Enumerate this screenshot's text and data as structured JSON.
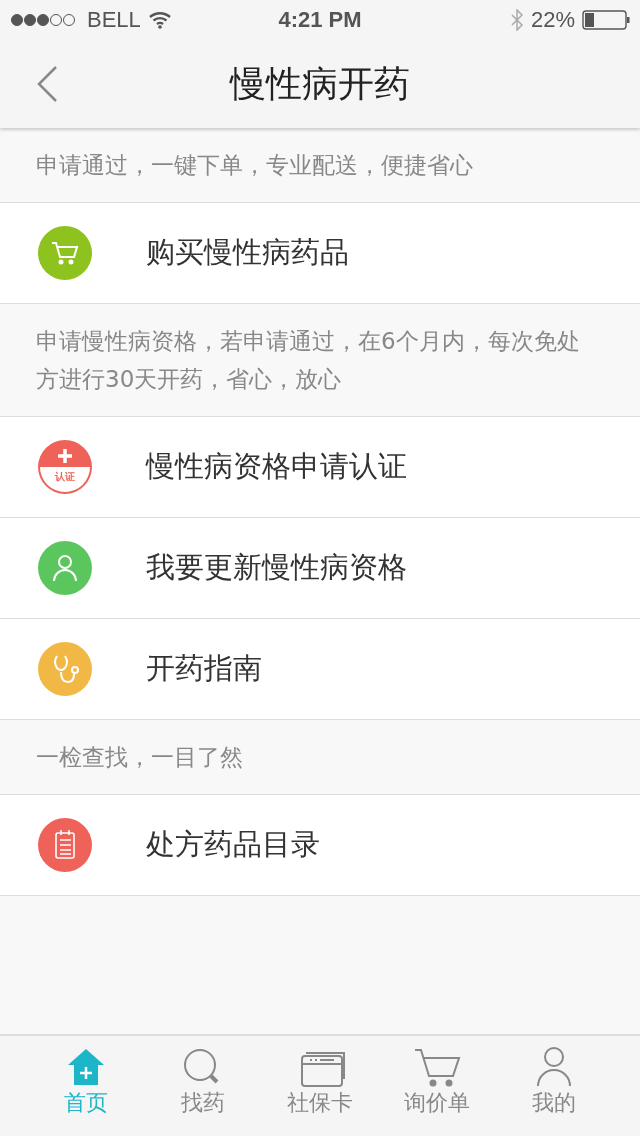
{
  "status_bar": {
    "carrier": "BELL",
    "time": "4:21 PM",
    "battery_text": "22%"
  },
  "nav": {
    "title": "慢性病开药"
  },
  "sections": [
    {
      "kind": "note",
      "text": "申请通过，一键下单，专业配送，便捷省心"
    },
    {
      "kind": "cart",
      "color": "#8ec21f",
      "label": "购买慢性病药品"
    },
    {
      "kind": "note",
      "text": "申请慢性病资格，若申请通过，在6个月内，每次免处方进行30天开药，省心，放心"
    },
    {
      "kind": "cert",
      "color": "#ee6259",
      "label": "慢性病资格申请认证",
      "icon_text": "认证"
    },
    {
      "kind": "person",
      "color": "#5cc65e",
      "label": "我要更新慢性病资格"
    },
    {
      "kind": "stethoscope",
      "color": "#f2b845",
      "label": "开药指南"
    },
    {
      "kind": "note",
      "text": "一检查找，一目了然"
    },
    {
      "kind": "list",
      "color": "#ee6259",
      "label": "处方药品目录"
    }
  ],
  "tabs": [
    {
      "kind": "home",
      "label": "首页",
      "selected": true
    },
    {
      "kind": "search",
      "label": "找药",
      "selected": false
    },
    {
      "kind": "card",
      "label": "社保卡",
      "selected": false
    },
    {
      "kind": "cart",
      "label": "询价单",
      "selected": false
    },
    {
      "kind": "person",
      "label": "我的",
      "selected": false
    }
  ]
}
